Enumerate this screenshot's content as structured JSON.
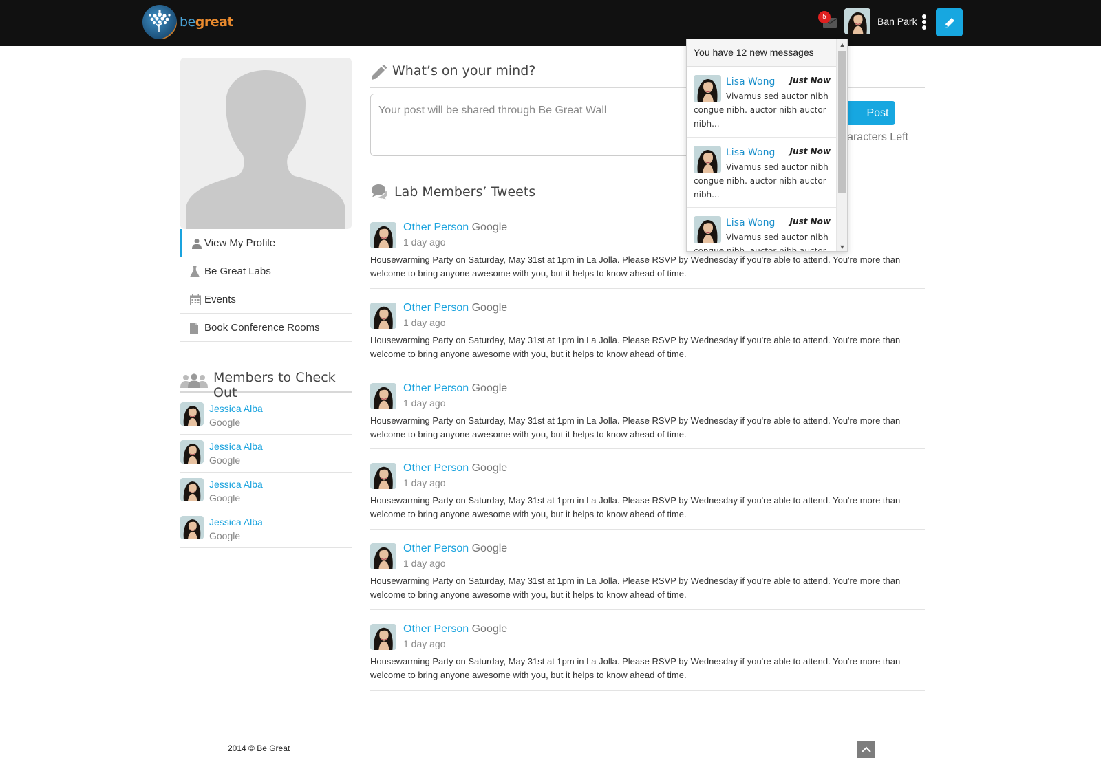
{
  "brand": {
    "be": "be",
    "great": "great",
    "be_color": "#4aa3d6",
    "great_color": "#e98a2e"
  },
  "topbar": {
    "message_count": "5",
    "username": "Ban Park",
    "icons": [
      "envelope-icon",
      "more-vertical-icon",
      "pencil-icon"
    ]
  },
  "sidebar": {
    "nav": [
      {
        "label": "View My Profile",
        "icon": "user-icon",
        "active": true
      },
      {
        "label": "Be Great Labs",
        "icon": "flask-icon",
        "active": false
      },
      {
        "label": "Events",
        "icon": "calendar-icon",
        "active": false
      },
      {
        "label": "Book Conference Rooms",
        "icon": "document-icon",
        "active": false
      }
    ],
    "members_title": "Members to Check Out",
    "members": [
      {
        "name": "Jessica Alba",
        "org": "Google"
      },
      {
        "name": "Jessica Alba",
        "org": "Google"
      },
      {
        "name": "Jessica Alba",
        "org": "Google"
      },
      {
        "name": "Jessica Alba",
        "org": "Google"
      }
    ]
  },
  "composer": {
    "title": "What’s on your mind?",
    "placeholder": "Your post will be shared through Be Great Wall",
    "post_label": "Post",
    "chars_left_label": "aracters Left"
  },
  "tweets": {
    "title": "Lab Members’ Tweets",
    "items": [
      {
        "name": "Other Person",
        "org": "Google",
        "time": "1 day ago",
        "body": "Housewarming Party on Saturday, May 31st at 1pm in La Jolla. Please RSVP by Wednesday if you're able to attend. You're more than welcome to bring anyone awesome with you, but it helps to know ahead of time."
      },
      {
        "name": "Other Person",
        "org": "Google",
        "time": "1 day ago",
        "body": "Housewarming Party on Saturday, May 31st at 1pm in La Jolla. Please RSVP by Wednesday if you're able to attend. You're more than welcome to bring anyone awesome with you, but it helps to know ahead of time."
      },
      {
        "name": "Other Person",
        "org": "Google",
        "time": "1 day ago",
        "body": "Housewarming Party on Saturday, May 31st at 1pm in La Jolla. Please RSVP by Wednesday if you're able to attend. You're more than welcome to bring anyone awesome with you, but it helps to know ahead of time."
      },
      {
        "name": "Other Person",
        "org": "Google",
        "time": "1 day ago",
        "body": "Housewarming Party on Saturday, May 31st at 1pm in La Jolla. Please RSVP by Wednesday if you're able to attend. You're more than welcome to bring anyone awesome with you, but it helps to know ahead of time."
      },
      {
        "name": "Other Person",
        "org": "Google",
        "time": "1 day ago",
        "body": "Housewarming Party on Saturday, May 31st at 1pm in La Jolla. Please RSVP by Wednesday if you're able to attend. You're more than welcome to bring anyone awesome with you, but it helps to know ahead of time."
      },
      {
        "name": "Other Person",
        "org": "Google",
        "time": "1 day ago",
        "body": "Housewarming Party on Saturday, May 31st at 1pm in La Jolla. Please RSVP by Wednesday if you're able to attend. You're more than welcome to bring anyone awesome with you, but it helps to know ahead of time."
      }
    ]
  },
  "messages_dropdown": {
    "header": "You have 12 new messages",
    "items": [
      {
        "name": "Lisa Wong",
        "time": "Just Now",
        "text": "Vivamus sed auctor nibh congue nibh. auctor nibh auctor nibh..."
      },
      {
        "name": "Lisa Wong",
        "time": "Just Now",
        "text": "Vivamus sed auctor nibh congue nibh. auctor nibh auctor nibh..."
      },
      {
        "name": "Lisa Wong",
        "time": "Just Now",
        "text": "Vivamus sed auctor nibh congue nibh. auctor nibh auctor"
      }
    ]
  },
  "footer": {
    "copyright": "2014 © Be Great"
  },
  "colors": {
    "accent": "#17a7e0",
    "topbar": "#111111",
    "badge": "#e02020",
    "link": "#1aa3de"
  }
}
